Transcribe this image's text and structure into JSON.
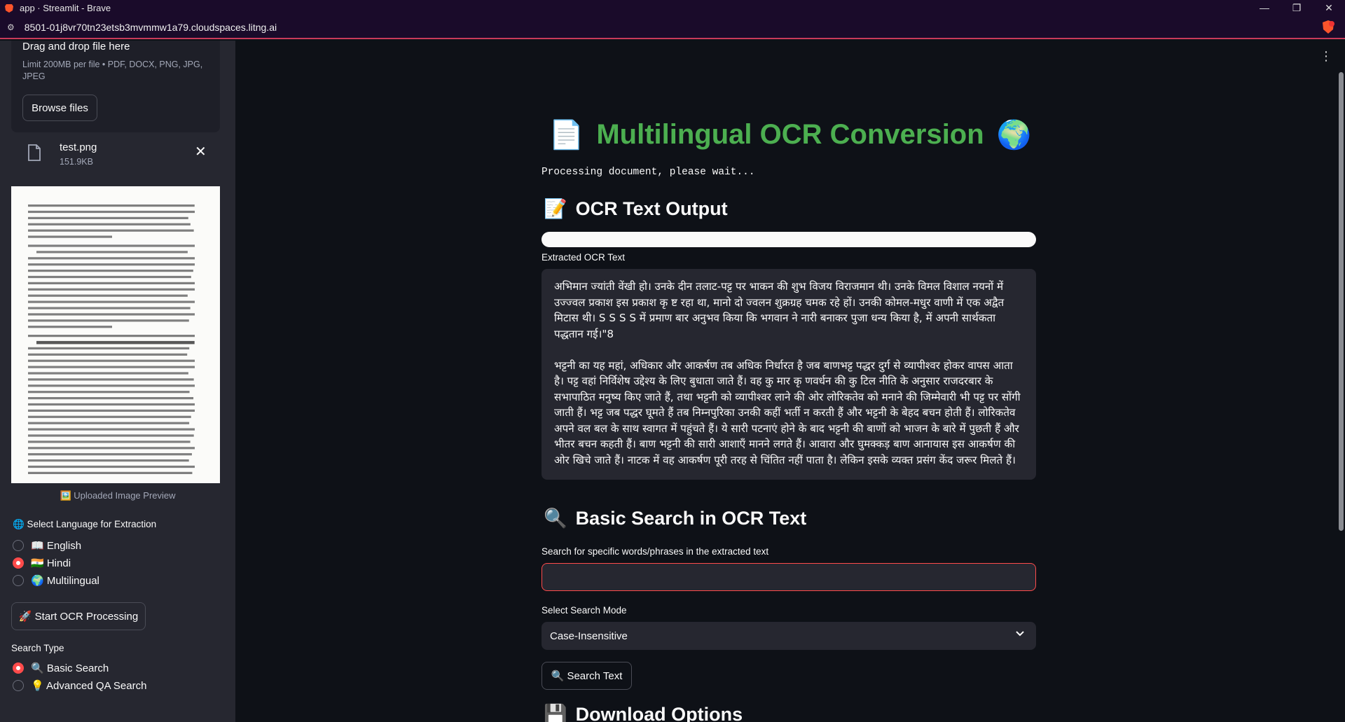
{
  "browser": {
    "window_title": "app · Streamlit - Brave",
    "url": "8501-01j8vr70tn23etsb3mvmmw1a79.cloudspaces.litng.ai",
    "controls": [
      "—",
      "❐",
      "✕"
    ]
  },
  "sidebar": {
    "uploader": {
      "title": "Drag and drop file here",
      "limit": "Limit 200MB per file • PDF, DOCX, PNG, JPG, JPEG",
      "browse_label": "Browse files"
    },
    "file": {
      "name": "test.png",
      "size": "151.9KB",
      "close": "✕"
    },
    "preview_caption": "🖼️ Uploaded Image Preview",
    "language_label": "🌐 Select Language for Extraction",
    "languages": [
      {
        "label": "📖 English",
        "selected": false
      },
      {
        "label": "🇮🇳 Hindi",
        "selected": true
      },
      {
        "label": "🌍 Multilingual",
        "selected": false
      }
    ],
    "ocr_button": "🚀 Start OCR Processing",
    "search_type_label": "Search Type",
    "search_types": [
      {
        "label": "🔍 Basic Search",
        "selected": true
      },
      {
        "label": "💡 Advanced QA Search",
        "selected": false
      }
    ]
  },
  "main": {
    "title_icon": "📄",
    "title": "Multilingual OCR Conversion",
    "title_icon_right": "🌍",
    "processing": "Processing document, please wait...",
    "ocr_header_icon": "📝",
    "ocr_header": "OCR Text Output",
    "progress": 1.0,
    "extracted_label": "Extracted OCR Text",
    "extracted_text": "अभिमान ज्यांती वेंखी हो। उनके दीन तलाट-पट्ट पर भाकन की शुभ विजय विराजमान थी। उनके विमल विशाल नयनों में उज्ज्वल प्रकाश इस प्रकाश कृ ष्ट रहा था, मानो दो ज्वलन शुक्रग्रह चमक रहे हों। उनकी कोमल-मधुर वाणी में एक अद्वैत मिटास थी। S S S S में प्रमाण बार अनुभव किया कि भगवान ने नारी बनाकर पुजा धन्य किया है, में अपनी सार्थकता पद्धतान गई।\"8\n\nभट्टनी का यह महां, अधिकार और आकर्षण तब अधिक निर्धारत है जब बाणभट्ट पद्धर दुर्ग से व्यापीश्वर होकर वापस आता है। पट्ट वहां निर्विशेष उद्देश्य के लिए बुधाता जाते हैं। वह कु मार कृ णवर्धन की कु टिल नीति के अनुसार राजदरबार के सभापाठित मनुष्य किए जाते हैं, तथा भट्टनी को व्यापीश्वर लाने की ओर लोरिकतेव को मनाने की जिम्मेवारी भी पट्ट पर सोंगी जाती हैं। भट्ट जब पद्धर घूमते हैं तब निम्नपुरिका उनकी कहीं भर्ती न करती हैं और भट्टनी के बेहद बचन होती हैं। लोरिकतेव अपने वल बल के साथ स्वागत में पहुंचते हैं। ये सारी पटनाएं होने के बाद भट्टनी की बाणों को भाजन के बारे में पुछती हैं और भीतर बचन कहती हैं। बाण भट्टनी की सारी आशाएँ मानने लगते हैं। आवारा और घुमक्कड़ बाण आनायास इस आकर्षण की ओर खिचे जाते हैं। नाटक में वह आकर्षण पूरी तरह से चिंतित नहीं पाता है। लेकिन इसके व्यक्त प्रसंग केंद जरूर मिलते हैं।",
    "search_header_icon": "🔍",
    "search_header": "Basic Search in OCR Text",
    "search_label": "Search for specific words/phrases in the extracted text",
    "search_value": "",
    "mode_label": "Select Search Mode",
    "mode_value": "Case-Insensitive",
    "search_button": "🔍 Search Text",
    "download_header_icon": "💾",
    "download_header": "Download Options"
  }
}
